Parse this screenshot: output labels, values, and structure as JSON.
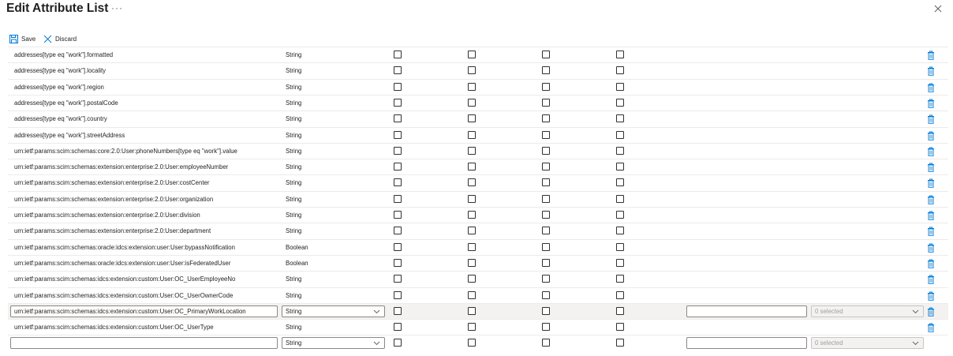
{
  "header": {
    "title": "Edit Attribute List",
    "more": "···"
  },
  "toolbar": {
    "save_label": "Save",
    "discard_label": "Discard"
  },
  "rows": [
    {
      "name": "addresses[type eq \"work\"].formatted",
      "type": "String"
    },
    {
      "name": "addresses[type eq \"work\"].locality",
      "type": "String"
    },
    {
      "name": "addresses[type eq \"work\"].region",
      "type": "String"
    },
    {
      "name": "addresses[type eq \"work\"].postalCode",
      "type": "String"
    },
    {
      "name": "addresses[type eq \"work\"].country",
      "type": "String"
    },
    {
      "name": "addresses[type eq \"work\"].streetAddress",
      "type": "String"
    },
    {
      "name": "urn:ietf:params:scim:schemas:core:2.0:User:phoneNumbers[type eq \"work\"].value",
      "type": "String"
    },
    {
      "name": "urn:ietf:params:scim:schemas:extension:enterprise:2.0:User:employeeNumber",
      "type": "String"
    },
    {
      "name": "urn:ietf:params:scim:schemas:extension:enterprise:2.0:User:costCenter",
      "type": "String"
    },
    {
      "name": "urn:ietf:params:scim:schemas:extension:enterprise:2.0:User:organization",
      "type": "String"
    },
    {
      "name": "urn:ietf:params:scim:schemas:extension:enterprise:2.0:User:division",
      "type": "String"
    },
    {
      "name": "urn:ietf:params:scim:schemas:extension:enterprise:2.0:User:department",
      "type": "String"
    },
    {
      "name": "urn:ietf:params:scim:schemas:oracle:idcs:extension:user:User:bypassNotification",
      "type": "Boolean"
    },
    {
      "name": "urn:ietf:params:scim:schemas:oracle:idcs:extension:user:User:isFederatedUser",
      "type": "Boolean"
    },
    {
      "name": "urn:ietf:params:scim:schemas:idcs:extension:custom:User:OC_UserEmployeeNo",
      "type": "String"
    },
    {
      "name": "urn:ietf:params:scim:schemas:idcs:extension:custom:User:OC_UserOwnerCode",
      "type": "String"
    }
  ],
  "edit_row": {
    "name_value": "urn:ietf:params:scim:schemas:idcs:extension:custom:User:OC_PrimaryWorkLocation",
    "type_value": "String",
    "multi_value": "0 selected"
  },
  "after_row": {
    "name": "urn:ietf:params:scim:schemas:idcs:extension:custom:User:OC_UserType",
    "type": "String"
  },
  "new_row": {
    "name_value": "",
    "type_value": "String",
    "multi_value": "0 selected"
  },
  "colors": {
    "accent": "#0078d4",
    "border": "#edebe9",
    "edit_row_bg": "#f3f2f1"
  },
  "icons": {
    "save": "save-icon",
    "discard": "close-icon",
    "delete": "trash-icon",
    "close": "close-icon",
    "dropdown": "chevron-down-icon"
  }
}
